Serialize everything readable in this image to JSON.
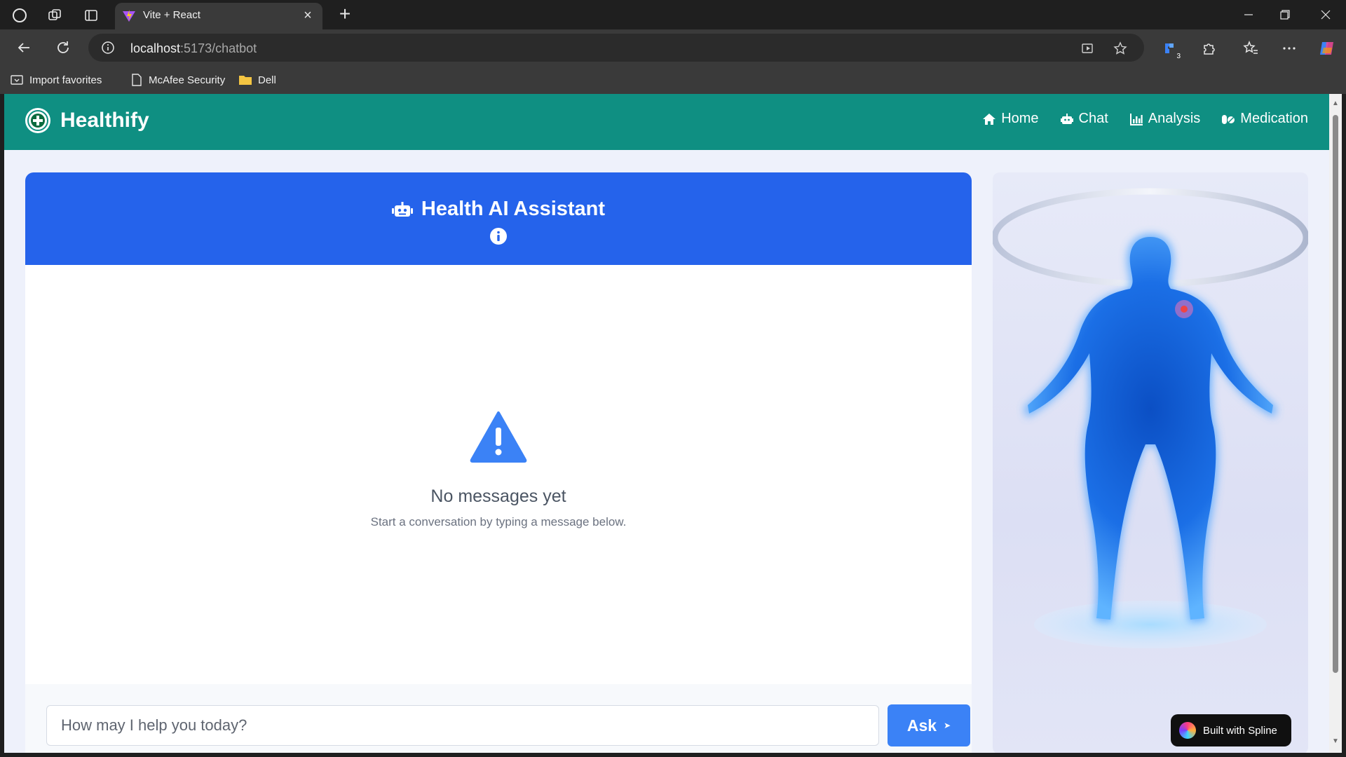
{
  "browser": {
    "tab_title": "Vite + React",
    "url_host": "localhost",
    "url_path": ":5173/chatbot",
    "extension_badge": "3",
    "favorites": [
      {
        "label": "Import favorites",
        "icon": "import-icon"
      },
      {
        "label": "McAfee Security",
        "icon": "page-icon"
      },
      {
        "label": "Dell",
        "icon": "folder-icon"
      }
    ]
  },
  "app": {
    "brand": "Healthify",
    "nav": [
      {
        "label": "Home",
        "icon": "home-icon"
      },
      {
        "label": "Chat",
        "icon": "robot-icon"
      },
      {
        "label": "Analysis",
        "icon": "chart-icon"
      },
      {
        "label": "Medication",
        "icon": "pills-icon"
      }
    ],
    "colors": {
      "header": "#0f8f82",
      "chat_header": "#2563eb",
      "button": "#3b82f6"
    }
  },
  "chat": {
    "title": "Health AI Assistant",
    "empty_title": "No messages yet",
    "empty_subtitle": "Start a conversation by typing a message below.",
    "input_placeholder": "How may I help you today?",
    "input_value": "",
    "ask_label": "Ask",
    "ask_arrow": "➤"
  },
  "scene": {
    "badge": "Built with Spline"
  }
}
